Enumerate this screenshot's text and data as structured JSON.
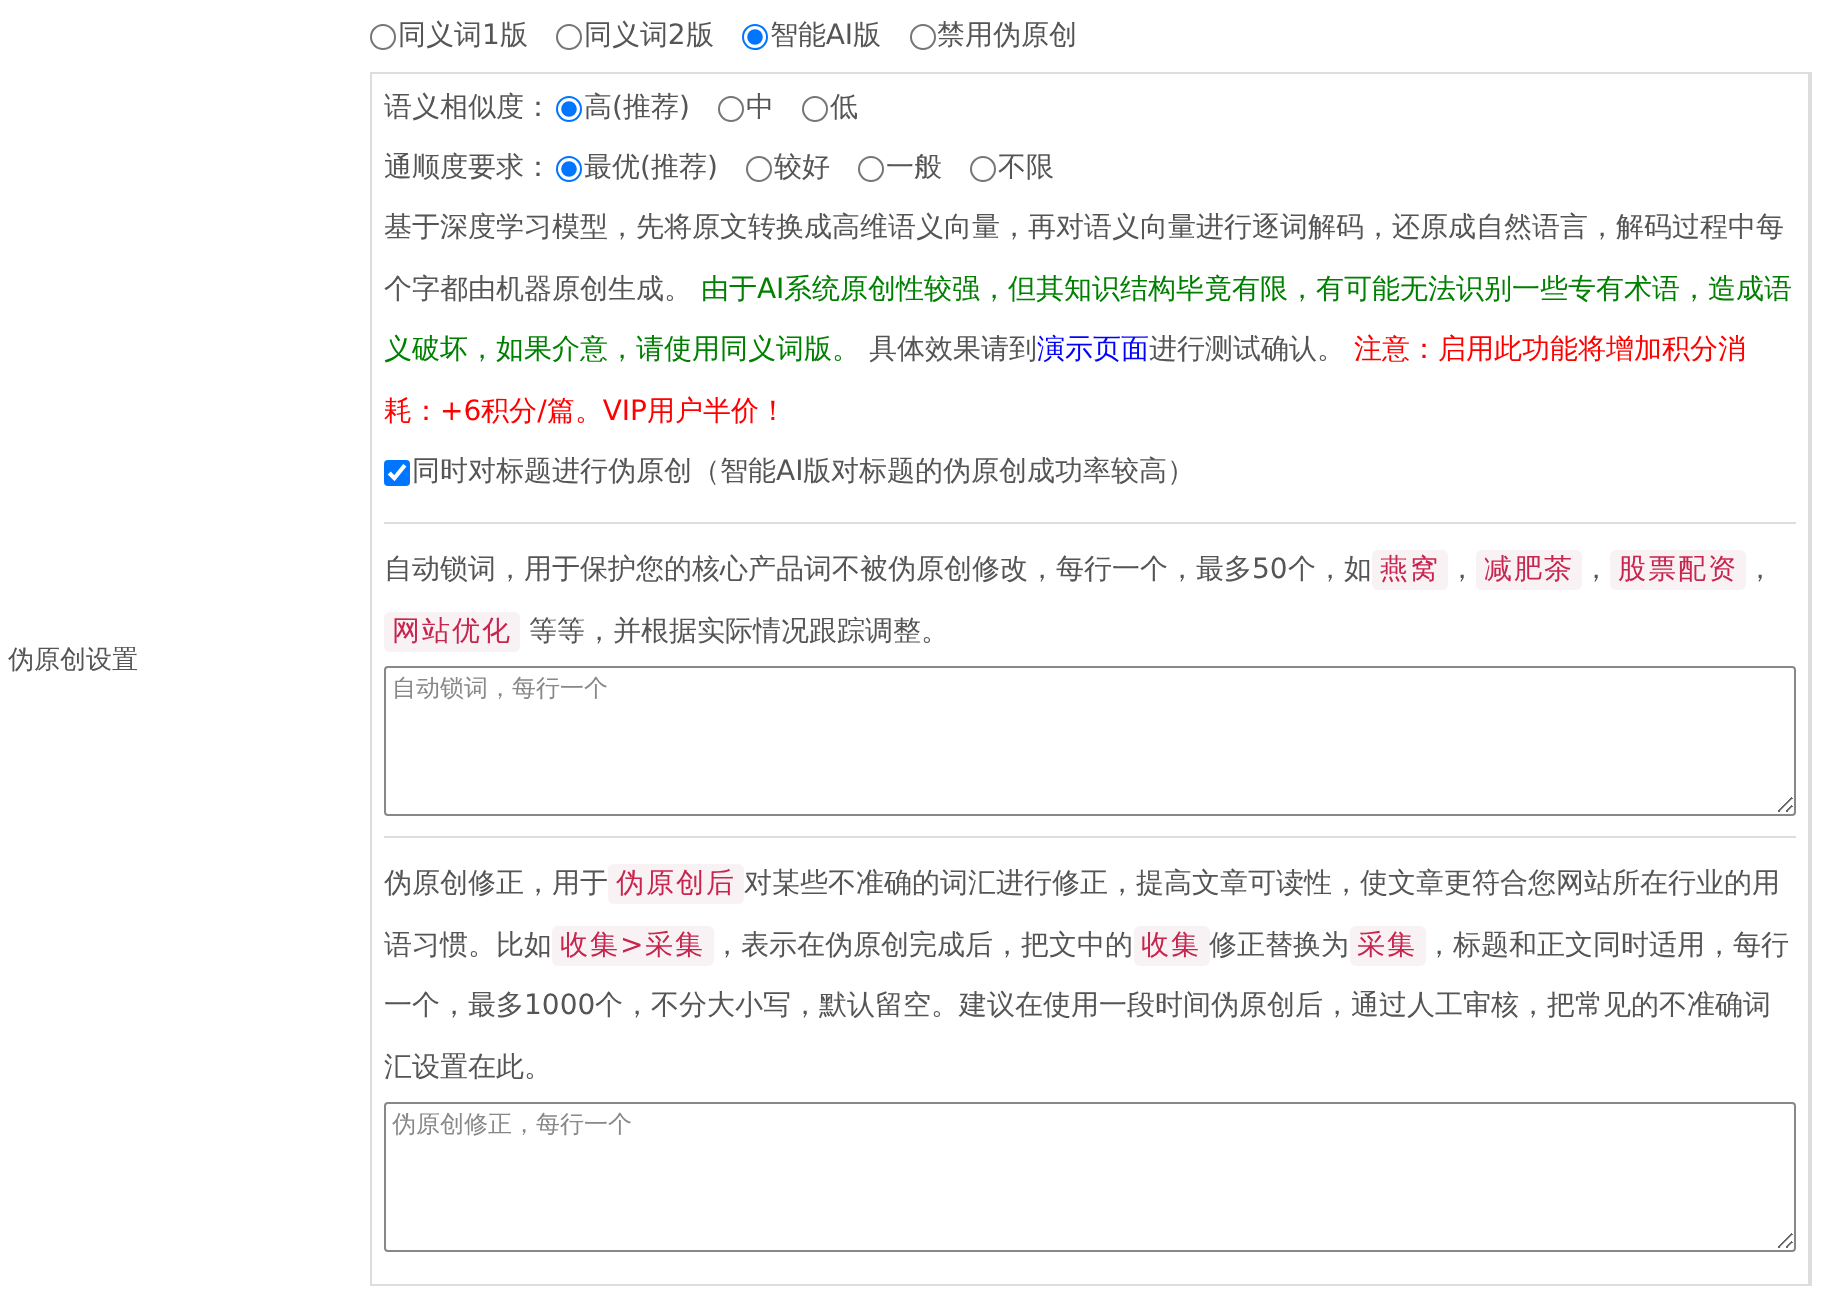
{
  "side_label": "伪原创设置",
  "modes": [
    {
      "label": "同义词1版",
      "selected": false
    },
    {
      "label": "同义词2版",
      "selected": false
    },
    {
      "label": "智能AI版",
      "selected": true
    },
    {
      "label": "禁用伪原创",
      "selected": false
    }
  ],
  "similarity": {
    "label": "语义相似度：",
    "options": [
      {
        "label": "高(推荐)",
        "selected": true
      },
      {
        "label": "中",
        "selected": false
      },
      {
        "label": "低",
        "selected": false
      }
    ]
  },
  "fluency": {
    "label": "通顺度要求：",
    "options": [
      {
        "label": "最优(推荐)",
        "selected": true
      },
      {
        "label": "较好",
        "selected": false
      },
      {
        "label": "一般",
        "selected": false
      },
      {
        "label": "不限",
        "selected": false
      }
    ]
  },
  "description": [
    {
      "kind": "plain",
      "text": "基于深度学习模型，先将原文转换成高维语义向量，再对语义向量进行逐词解码，还原成自然语言，解码过程中每个字都由机器原创生成。 "
    },
    {
      "kind": "green",
      "text": "由于AI系统原创性较强，但其知识结构毕竟有限，有可能无法识别一些专有术语，造成语义破坏，如果介意，请使用同义词版。"
    },
    {
      "kind": "plain",
      "text": " 具体效果请到"
    },
    {
      "kind": "link",
      "text": "演示页面"
    },
    {
      "kind": "plain",
      "text": "进行测试确认。 "
    },
    {
      "kind": "red",
      "text": "注意：启用此功能将增加积分消耗：+6积分/篇。VIP用户半价！"
    }
  ],
  "title_option": {
    "label": "同时对标题进行伪原创（智能AI版对标题的伪原创成功率较高）",
    "checked": true
  },
  "lock_words": {
    "description": [
      {
        "kind": "plain",
        "text": "自动锁词，用于保护您的核心产品词不被伪原创修改，每行一个，最多50个，如"
      },
      {
        "kind": "tag",
        "text": "燕窝"
      },
      {
        "kind": "plain",
        "text": "，"
      },
      {
        "kind": "tag",
        "text": "减肥茶"
      },
      {
        "kind": "plain",
        "text": "，"
      },
      {
        "kind": "tag",
        "text": "股票配资"
      },
      {
        "kind": "plain",
        "text": "，"
      },
      {
        "kind": "tag",
        "text": "网站优化"
      },
      {
        "kind": "plain",
        "text": " 等等，并根据实际情况跟踪调整。"
      }
    ],
    "placeholder": "自动锁词，每行一个"
  },
  "correction": {
    "description": [
      {
        "kind": "plain",
        "text": "伪原创修正，用于"
      },
      {
        "kind": "tag",
        "text": "伪原创后"
      },
      {
        "kind": "plain",
        "text": "对某些不准确的词汇进行修正，提高文章可读性，使文章更符合您网站所在行业的用语习惯。比如"
      },
      {
        "kind": "tag",
        "text": "收集>采集"
      },
      {
        "kind": "plain",
        "text": "，表示在伪原创完成后，把文中的"
      },
      {
        "kind": "tag",
        "text": "收集"
      },
      {
        "kind": "plain",
        "text": "修正替换为"
      },
      {
        "kind": "tag",
        "text": "采集"
      },
      {
        "kind": "plain",
        "text": "，标题和正文同时适用，每行一个，最多1000个，不分大小写，默认留空。建议在使用一段时间伪原创后，通过人工审核，把常见的不准确词汇设置在此。"
      }
    ],
    "placeholder": "伪原创修正，每行一个"
  }
}
